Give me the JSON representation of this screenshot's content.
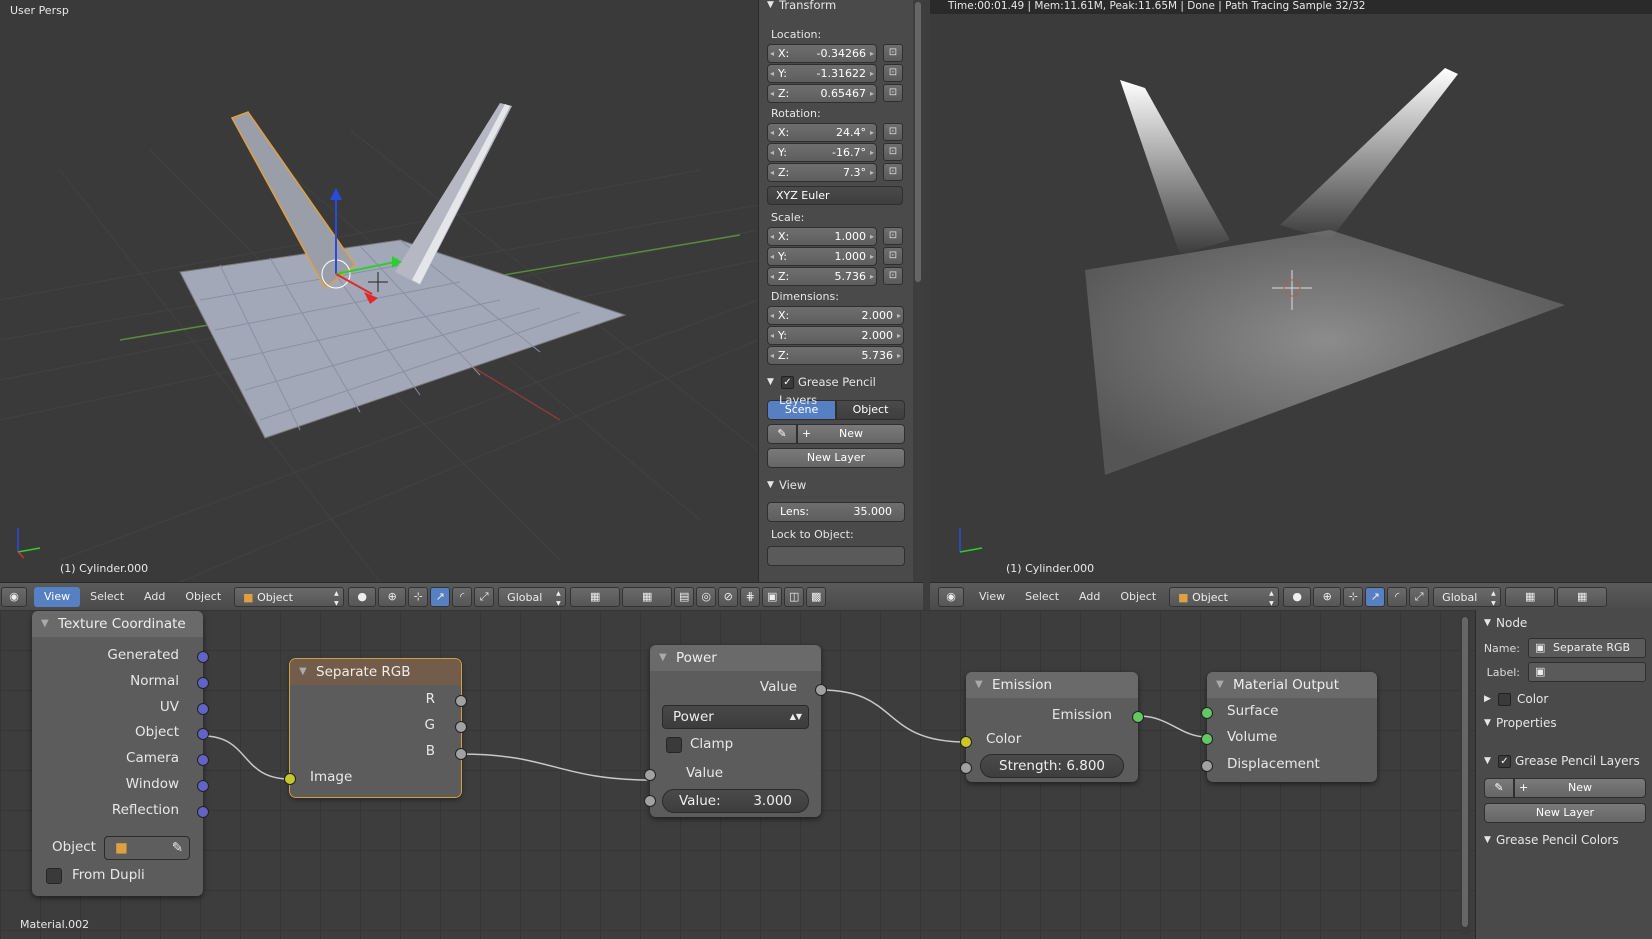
{
  "left_viewport": {
    "view_label": "User Persp",
    "object_label": "(1) Cylinder.000"
  },
  "right_viewport": {
    "status": "Time:00:01.49 | Mem:11.61M, Peak:11.65M | Done | Path Tracing Sample 32/32",
    "object_label": "(1) Cylinder.000"
  },
  "transform_panel": {
    "title": "Transform",
    "location_label": "Location:",
    "location": [
      {
        "k": "X:",
        "v": "-0.34266"
      },
      {
        "k": "Y:",
        "v": "-1.31622"
      },
      {
        "k": "Z:",
        "v": "0.65467"
      }
    ],
    "rotation_label": "Rotation:",
    "rotation": [
      {
        "k": "X:",
        "v": "24.4°"
      },
      {
        "k": "Y:",
        "v": "-16.7°"
      },
      {
        "k": "Z:",
        "v": "7.3°"
      }
    ],
    "rotation_mode": "XYZ Euler",
    "scale_label": "Scale:",
    "scale": [
      {
        "k": "X:",
        "v": "1.000"
      },
      {
        "k": "Y:",
        "v": "1.000"
      },
      {
        "k": "Z:",
        "v": "5.736"
      }
    ],
    "dimensions_label": "Dimensions:",
    "dimensions": [
      {
        "k": "X:",
        "v": "2.000"
      },
      {
        "k": "Y:",
        "v": "2.000"
      },
      {
        "k": "Z:",
        "v": "5.736"
      }
    ]
  },
  "grease_panel": {
    "title": "Grease Pencil Layers",
    "scene_tab": "Scene",
    "object_tab": "Object",
    "new_label": "New",
    "new_layer_label": "New Layer"
  },
  "view_panel": {
    "title": "View",
    "lens_label": "Lens:",
    "lens_value": "35.000",
    "lock_label": "Lock to Object:"
  },
  "header_left": {
    "view": "View",
    "select": "Select",
    "add": "Add",
    "object": "Object",
    "mode": "Object Mode",
    "orientation": "Global"
  },
  "header_right": {
    "view": "View",
    "select": "Select",
    "add": "Add",
    "object": "Object",
    "mode": "Object Mode",
    "orientation": "Global"
  },
  "nodes": {
    "texcoord": {
      "title": "Texture Coordinate",
      "outputs": [
        "Generated",
        "Normal",
        "UV",
        "Object",
        "Camera",
        "Window",
        "Reflection"
      ],
      "object_label": "Object",
      "from_dupli": "From Dupli"
    },
    "seprgb": {
      "title": "Separate RGB",
      "r": "R",
      "g": "G",
      "b": "B",
      "image": "Image"
    },
    "power": {
      "title": "Power",
      "value_out": "Value",
      "op": "Power",
      "clamp": "Clamp",
      "value_in": "Value",
      "value_field_label": "Value:",
      "value_field": "3.000"
    },
    "emission": {
      "title": "Emission",
      "out": "Emission",
      "color": "Color",
      "strength_label": "Strength:",
      "strength": "6.800"
    },
    "output": {
      "title": "Material Output",
      "surface": "Surface",
      "volume": "Volume",
      "displacement": "Displacement"
    }
  },
  "material_label": "Material.002",
  "node_props": {
    "node_title": "Node",
    "name_label": "Name:",
    "name_value": "Separate RGB",
    "label_label": "Label:",
    "color_title": "Color",
    "properties_title": "Properties",
    "grease_title": "Grease Pencil Layers",
    "new_label": "New",
    "new_layer_label": "New Layer",
    "grease_colors_title": "Grease Pencil Colors"
  }
}
